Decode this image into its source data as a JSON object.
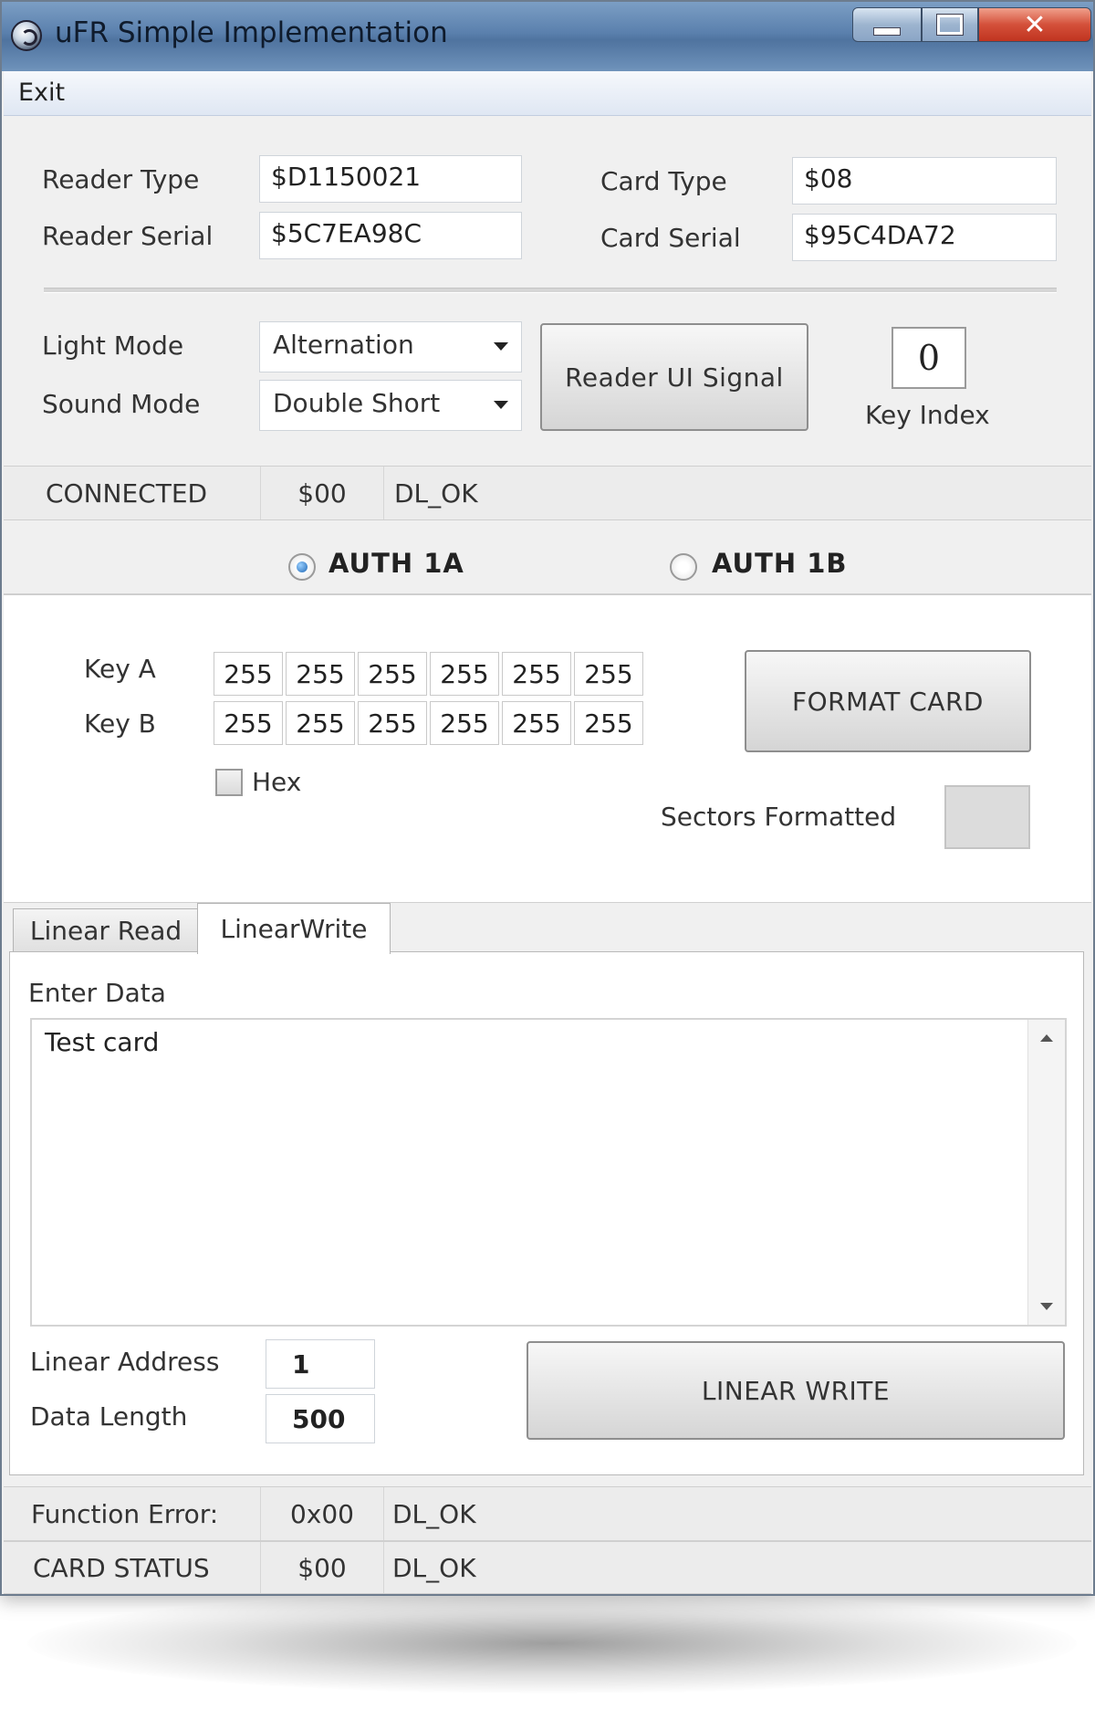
{
  "window": {
    "title": "uFR Simple Implementation"
  },
  "menu": {
    "exit": "Exit"
  },
  "reader": {
    "type_label": "Reader Type",
    "type_value": "$D1150021",
    "serial_label": "Reader Serial",
    "serial_value": "$5C7EA98C"
  },
  "card": {
    "type_label": "Card Type",
    "type_value": "$08",
    "serial_label": "Card Serial",
    "serial_value": "$95C4DA72"
  },
  "signal": {
    "light_label": "Light Mode",
    "light_value": "Alternation",
    "sound_label": "Sound Mode",
    "sound_value": "Double Short",
    "button_label": "Reader UI Signal",
    "key_index_value": "0",
    "key_index_label": "Key Index"
  },
  "connection_status": {
    "status": "CONNECTED",
    "code": "$00",
    "message": "DL_OK"
  },
  "auth": {
    "option_1a": "AUTH 1A",
    "option_1b": "AUTH 1B",
    "selected": "AUTH 1A"
  },
  "keys": {
    "key_a_label": "Key A",
    "key_a": [
      "255",
      "255",
      "255",
      "255",
      "255",
      "255"
    ],
    "key_b_label": "Key B",
    "key_b": [
      "255",
      "255",
      "255",
      "255",
      "255",
      "255"
    ],
    "hex_label": "Hex"
  },
  "format": {
    "button_label": "FORMAT CARD",
    "sectors_label": "Sectors Formatted"
  },
  "tabs": [
    {
      "label": "Linear Read"
    },
    {
      "label": "LinearWrite"
    }
  ],
  "write": {
    "enter_data_label": "Enter Data",
    "data_value": "Test card",
    "address_label": "Linear Address",
    "address_value": "1",
    "length_label": "Data Length",
    "length_value": "500",
    "button_label": "LINEAR WRITE"
  },
  "function_error": {
    "label": "Function Error:",
    "code": "0x00",
    "message": "DL_OK"
  },
  "card_status": {
    "label": "CARD STATUS",
    "code": "$00",
    "message": "DL_OK"
  },
  "colors": {
    "titlebar": "#5a80ad",
    "close_button": "#d4503a",
    "radio_selected": "#1f67b5"
  }
}
